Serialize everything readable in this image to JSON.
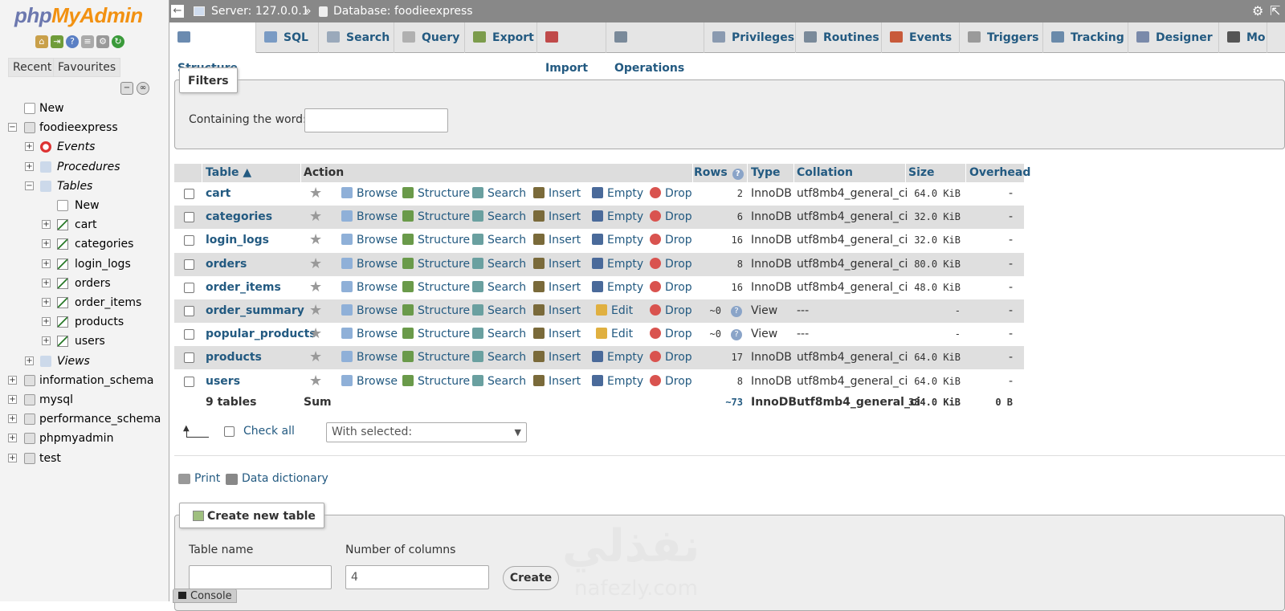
{
  "nav": {
    "logo_php": "php",
    "logo_my": "MyAdmin",
    "recent": "Recent",
    "favourites": "Favourites",
    "tree": [
      {
        "label": "New",
        "level": 0,
        "kind": "new"
      },
      {
        "label": "foodieexpress",
        "level": 0,
        "kind": "db",
        "expanded": true
      },
      {
        "label": "Events",
        "level": 1,
        "kind": "group",
        "italic": true
      },
      {
        "label": "Procedures",
        "level": 1,
        "kind": "group",
        "italic": true
      },
      {
        "label": "Tables",
        "level": 1,
        "kind": "group",
        "italic": true,
        "expanded": true
      },
      {
        "label": "New",
        "level": 2,
        "kind": "new"
      },
      {
        "label": "cart",
        "level": 2,
        "kind": "table"
      },
      {
        "label": "categories",
        "level": 2,
        "kind": "table"
      },
      {
        "label": "login_logs",
        "level": 2,
        "kind": "table"
      },
      {
        "label": "orders",
        "level": 2,
        "kind": "table"
      },
      {
        "label": "order_items",
        "level": 2,
        "kind": "table"
      },
      {
        "label": "products",
        "level": 2,
        "kind": "table"
      },
      {
        "label": "users",
        "level": 2,
        "kind": "table"
      },
      {
        "label": "Views",
        "level": 1,
        "kind": "group",
        "italic": true
      },
      {
        "label": "information_schema",
        "level": 0,
        "kind": "db"
      },
      {
        "label": "mysql",
        "level": 0,
        "kind": "db"
      },
      {
        "label": "performance_schema",
        "level": 0,
        "kind": "db"
      },
      {
        "label": "phpmyadmin",
        "level": 0,
        "kind": "db"
      },
      {
        "label": "test",
        "level": 0,
        "kind": "db"
      }
    ]
  },
  "breadcrumb": {
    "server": "Server: 127.0.0.1",
    "sep": "»",
    "database": "Database: foodieexpress"
  },
  "tabs": [
    "Structure",
    "SQL",
    "Search",
    "Query",
    "Export",
    "Import",
    "Operations",
    "Privileges",
    "Routines",
    "Events",
    "Triggers",
    "Tracking",
    "Designer",
    "Mo"
  ],
  "filters": {
    "legend": "Filters",
    "label": "Containing the word:",
    "value": ""
  },
  "table": {
    "headers": {
      "table": "Table",
      "action": "Action",
      "rows": "Rows",
      "type": "Type",
      "collation": "Collation",
      "size": "Size",
      "overhead": "Overhead"
    },
    "actions": {
      "browse": "Browse",
      "structure": "Structure",
      "search": "Search",
      "insert": "Insert",
      "empty": "Empty",
      "edit": "Edit",
      "drop": "Drop"
    },
    "rows": [
      {
        "name": "cart",
        "view": false,
        "rows": "2",
        "type": "InnoDB",
        "collation": "utf8mb4_general_ci",
        "size": "64.0 KiB",
        "overhead": "-"
      },
      {
        "name": "categories",
        "view": false,
        "rows": "6",
        "type": "InnoDB",
        "collation": "utf8mb4_general_ci",
        "size": "32.0 KiB",
        "overhead": "-"
      },
      {
        "name": "login_logs",
        "view": false,
        "rows": "16",
        "type": "InnoDB",
        "collation": "utf8mb4_general_ci",
        "size": "32.0 KiB",
        "overhead": "-"
      },
      {
        "name": "orders",
        "view": false,
        "rows": "8",
        "type": "InnoDB",
        "collation": "utf8mb4_general_ci",
        "size": "80.0 KiB",
        "overhead": "-"
      },
      {
        "name": "order_items",
        "view": false,
        "rows": "16",
        "type": "InnoDB",
        "collation": "utf8mb4_general_ci",
        "size": "48.0 KiB",
        "overhead": "-"
      },
      {
        "name": "order_summary",
        "view": true,
        "rows": "~0",
        "type": "View",
        "collation": "---",
        "size": "-",
        "overhead": "-"
      },
      {
        "name": "popular_products",
        "view": true,
        "rows": "~0",
        "type": "View",
        "collation": "---",
        "size": "-",
        "overhead": "-"
      },
      {
        "name": "products",
        "view": false,
        "rows": "17",
        "type": "InnoDB",
        "collation": "utf8mb4_general_ci",
        "size": "64.0 KiB",
        "overhead": "-"
      },
      {
        "name": "users",
        "view": false,
        "rows": "8",
        "type": "InnoDB",
        "collation": "utf8mb4_general_ci",
        "size": "64.0 KiB",
        "overhead": "-"
      }
    ],
    "summary": {
      "tables": "9 tables",
      "sum": "Sum",
      "rows": "~73",
      "type": "InnoDB",
      "collation": "utf8mb4_general_ci",
      "size": "384.0 KiB",
      "overhead": "0 B"
    }
  },
  "bulk": {
    "check_all": "Check all",
    "with_selected": "With selected:"
  },
  "links": {
    "print": "Print",
    "dictionary": "Data dictionary"
  },
  "create": {
    "legend": "Create new table",
    "name_label": "Table name",
    "cols_label": "Number of columns",
    "cols_value": "4",
    "button": "Create"
  },
  "console": "Console",
  "watermark": {
    "arabic": "نفذلي",
    "latin": "nafezly.com"
  },
  "colors": {
    "link": "#235a81",
    "drop": "#d9534f",
    "rowalt": "#dfdfdf"
  }
}
